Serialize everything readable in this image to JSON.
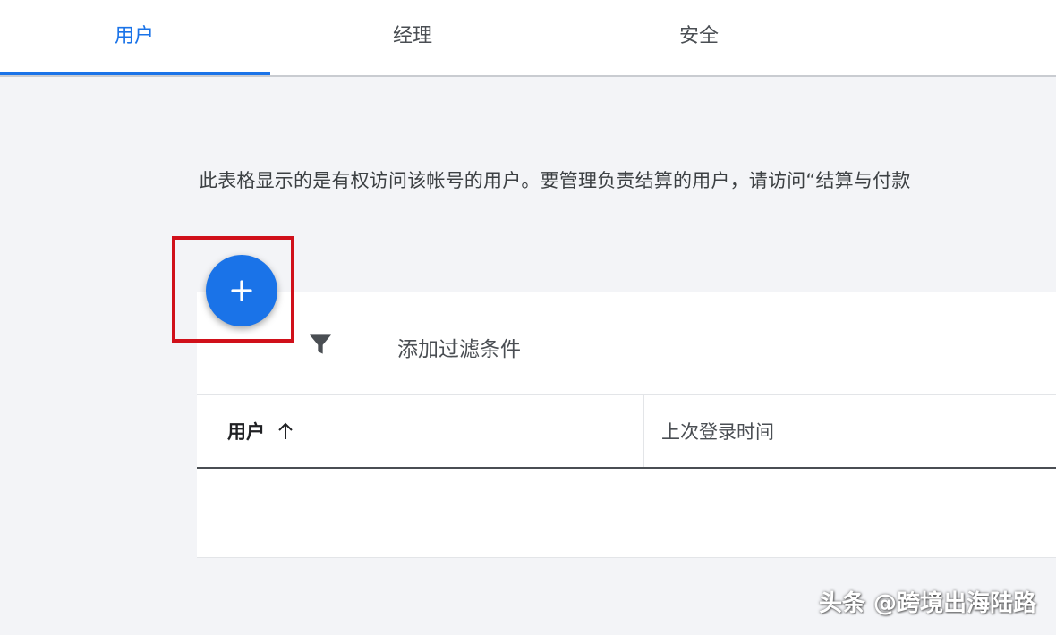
{
  "tabs": [
    {
      "label": "用户",
      "active": true
    },
    {
      "label": "经理",
      "active": false
    },
    {
      "label": "安全",
      "active": false
    }
  ],
  "description": "此表格显示的是有权访问该帐号的用户。要管理负责结算的用户，请访问“结算与付款",
  "add_button": {
    "icon": "plus-icon"
  },
  "filter": {
    "icon": "filter-icon",
    "label": "添加过滤条件"
  },
  "table": {
    "columns": [
      {
        "label": "用户",
        "sort": "ascending",
        "sort_icon": "arrow-up-icon"
      },
      {
        "label": "上次登录时间"
      }
    ],
    "rows": []
  },
  "watermark": "头条 @跨境出海陆路",
  "colors": {
    "accent": "#1a73e8",
    "highlight": "#d0101a"
  }
}
